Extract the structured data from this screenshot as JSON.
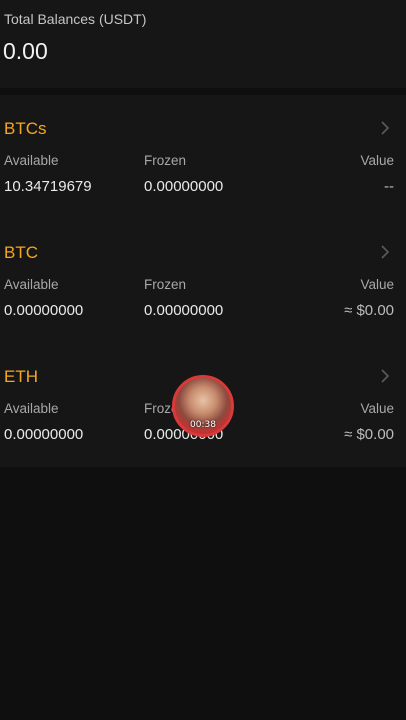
{
  "total": {
    "label": "Total Balances (USDT)",
    "value": "0.00"
  },
  "columns": {
    "available": "Available",
    "frozen": "Frozen",
    "value": "Value"
  },
  "assets": [
    {
      "name": "BTCs",
      "available": "10.34719679",
      "frozen": "0.00000000",
      "value": "--"
    },
    {
      "name": "BTC",
      "available": "0.00000000",
      "frozen": "0.00000000",
      "value": "≈ $0.00"
    },
    {
      "name": "ETH",
      "available": "0.00000000",
      "frozen": "0.00000000",
      "value": "≈ $0.00"
    }
  ],
  "recorder": {
    "time": "00:38"
  },
  "colors": {
    "accent": "#f6a623",
    "recorder_ring": "#d83a3a"
  },
  "icons": {
    "row_arrow": "chevron-right-icon"
  }
}
